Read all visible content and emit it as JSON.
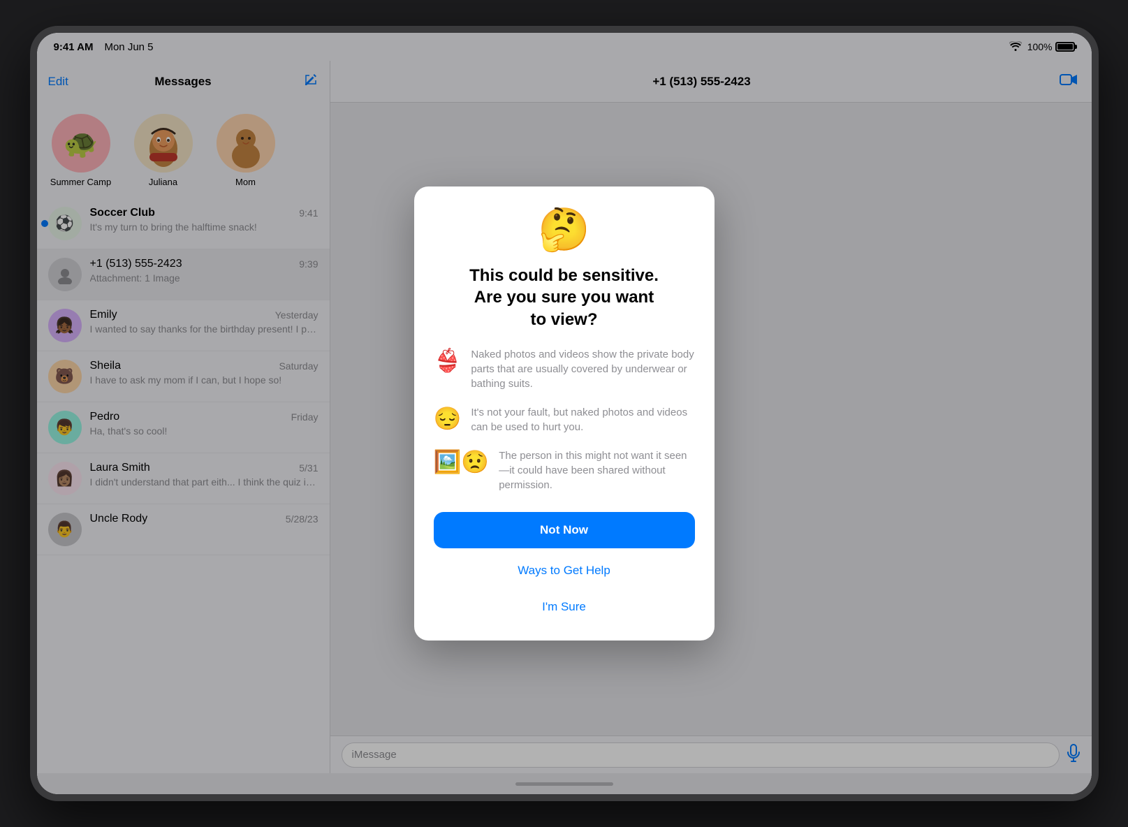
{
  "statusBar": {
    "time": "9:41 AM",
    "date": "Mon Jun 5",
    "battery": "100%",
    "batteryIcon": "battery-full"
  },
  "sidebar": {
    "editLabel": "Edit",
    "title": "Messages",
    "pinnedContacts": [
      {
        "name": "Summer Camp",
        "emoji": "🐢",
        "bg": "pink"
      },
      {
        "name": "Juliana",
        "emoji": "👧",
        "bg": "yellow"
      },
      {
        "name": "Mom",
        "emoji": "👩",
        "bg": "peach"
      }
    ],
    "messages": [
      {
        "sender": "Soccer Club",
        "time": "9:41",
        "preview": "It's my turn to bring the halftime snack!",
        "emoji": "⚽",
        "avatarBg": "avatar-soccer",
        "unread": true,
        "selected": false
      },
      {
        "sender": "+1 (513) 555-2423",
        "time": "9:39",
        "preview": "Attachment: 1 Image",
        "emoji": "👤",
        "avatarBg": "avatar-unknown",
        "unread": false,
        "selected": true
      },
      {
        "sender": "Emily",
        "time": "Yesterday",
        "preview": "I wanted to say thanks for the birthday present! I play with it every day in the yard!",
        "emoji": "👧🏾",
        "avatarBg": "avatar-purple",
        "unread": false,
        "selected": false
      },
      {
        "sender": "Sheila",
        "time": "Saturday",
        "preview": "I have to ask my mom if I can, but I hope so!",
        "emoji": "🐻",
        "avatarBg": "avatar-orange",
        "unread": false,
        "selected": false
      },
      {
        "sender": "Pedro",
        "time": "Friday",
        "preview": "Ha, that's so cool!",
        "emoji": "👦",
        "avatarBg": "avatar-teal",
        "unread": false,
        "selected": false
      },
      {
        "sender": "Laura Smith",
        "time": "5/31",
        "preview": "I didn't understand that part eith... I think the quiz is on Thursday now.",
        "emoji": "👩🏽",
        "avatarBg": "avatar-pink2",
        "unread": false,
        "selected": false
      },
      {
        "sender": "Uncle Rody",
        "time": "5/28/23",
        "preview": "",
        "emoji": "👨",
        "avatarBg": "avatar-gray",
        "unread": false,
        "selected": false
      }
    ]
  },
  "messageView": {
    "contactName": "+1 (513) 555-2423",
    "inputPlaceholder": "iMessage"
  },
  "modal": {
    "emoji": "🤔",
    "title": "This could be sensitive.\nAre you sure you want\nto view?",
    "items": [
      {
        "emoji": "👙",
        "text": "Naked photos and videos show the private body parts that are usually covered by underwear or bathing suits."
      },
      {
        "emoji": "😔",
        "text": "It's not your fault, but naked photos and videos can be used to hurt you."
      },
      {
        "emoji": "🖼️",
        "text": "The person in this might not want it seen—it could have been shared without permission."
      }
    ],
    "buttons": {
      "notNow": "Not Now",
      "waysToGetHelp": "Ways to Get Help",
      "imSure": "I'm Sure"
    }
  }
}
